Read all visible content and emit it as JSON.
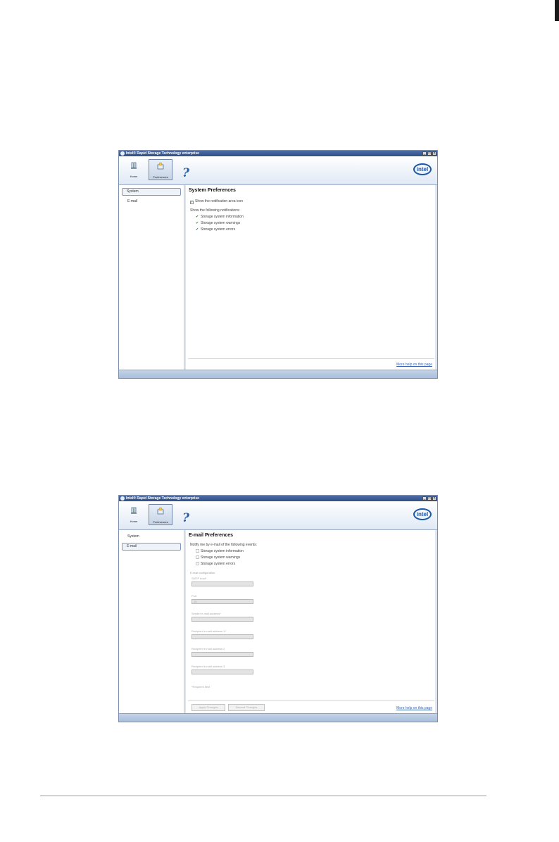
{
  "windows": [
    {
      "title": "Intel® Rapid Storage Technology enterprise",
      "toolbar": {
        "home_label": "Home",
        "preferences_label": "Preferences"
      },
      "sidebar": {
        "items": [
          {
            "label": "System"
          },
          {
            "label": "E-mail"
          }
        ],
        "selected": "System"
      },
      "content": {
        "heading": "System Preferences",
        "show_icon_label": "Show the notification area icon",
        "show_icon_checked": true,
        "notifications_heading": "Show the following notifications:",
        "notifications": [
          {
            "label": "Storage system information",
            "checked": true
          },
          {
            "label": "Storage system warnings",
            "checked": true
          },
          {
            "label": "Storage system errors",
            "checked": true
          }
        ],
        "help_link": "More help on this page"
      }
    },
    {
      "title": "Intel® Rapid Storage Technology enterprise",
      "toolbar": {
        "home_label": "Home",
        "preferences_label": "Preferences"
      },
      "sidebar": {
        "items": [
          {
            "label": "System"
          },
          {
            "label": "E-mail"
          }
        ],
        "selected": "E-mail"
      },
      "content": {
        "heading": "E-mail Preferences",
        "notify_heading": "Notify me by e-mail of the following events:",
        "events": [
          {
            "label": "Storage system information",
            "checked": false
          },
          {
            "label": "Storage system warnings",
            "checked": false
          },
          {
            "label": "Storage system errors",
            "checked": false
          }
        ],
        "config_heading": "E-mail configuration",
        "fields": [
          {
            "label": "SMTP host*",
            "value": ""
          },
          {
            "label": "Port",
            "value": "25"
          },
          {
            "label": "Sender e-mail address*",
            "value": ""
          },
          {
            "label": "Recipient e-mail address 1*",
            "value": ""
          },
          {
            "label": "Recipient e-mail address 2",
            "value": ""
          },
          {
            "label": "Recipient e-mail address 3",
            "value": ""
          }
        ],
        "required_note": "*Required field",
        "apply_button": "Apply Changes",
        "discard_button": "Discard Changes",
        "help_link": "More help on this page"
      }
    }
  ],
  "colors": {
    "titlebar": "#3f5f96",
    "link": "#3a64b0",
    "intel_blue": "#1a58a8",
    "check_green": "#2b6a2b"
  },
  "icons": {
    "home": "home-icon",
    "preferences": "preferences-icon",
    "help": "help-icon",
    "intel": "intel-logo"
  }
}
